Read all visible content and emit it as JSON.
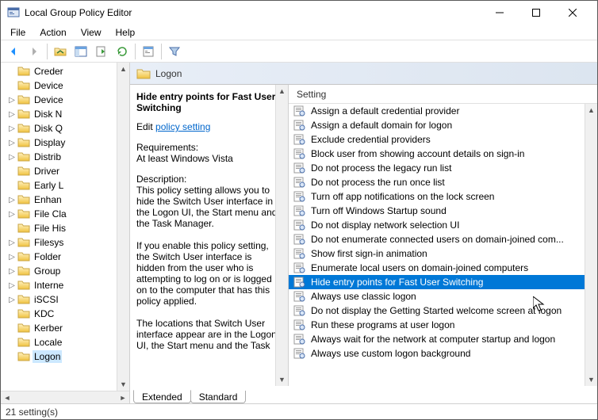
{
  "window": {
    "title": "Local Group Policy Editor"
  },
  "menu": [
    "File",
    "Action",
    "View",
    "Help"
  ],
  "tree": {
    "selected": "Logon",
    "items": [
      {
        "label": "Creder",
        "exp": ""
      },
      {
        "label": "Device",
        "exp": ""
      },
      {
        "label": "Device",
        "exp": ">"
      },
      {
        "label": "Disk N",
        "exp": ">"
      },
      {
        "label": "Disk Q",
        "exp": ">"
      },
      {
        "label": "Display",
        "exp": ">"
      },
      {
        "label": "Distrib",
        "exp": ">"
      },
      {
        "label": "Driver",
        "exp": ""
      },
      {
        "label": "Early L",
        "exp": ""
      },
      {
        "label": "Enhan",
        "exp": ">"
      },
      {
        "label": "File Cla",
        "exp": ">"
      },
      {
        "label": "File His",
        "exp": ""
      },
      {
        "label": "Filesys",
        "exp": ">"
      },
      {
        "label": "Folder",
        "exp": ">"
      },
      {
        "label": "Group",
        "exp": ">"
      },
      {
        "label": "Interne",
        "exp": ">"
      },
      {
        "label": "iSCSI",
        "exp": ">"
      },
      {
        "label": "KDC",
        "exp": ""
      },
      {
        "label": "Kerber",
        "exp": ""
      },
      {
        "label": "Locale",
        "exp": ""
      },
      {
        "label": "Logon",
        "exp": ""
      }
    ]
  },
  "content": {
    "heading": "Logon",
    "setting_title": "Hide entry points for Fast User Switching",
    "edit_prefix": "Edit ",
    "edit_link": "policy setting ",
    "req_hdr": "Requirements:",
    "req_val": "At least Windows Vista",
    "desc_hdr": "Description:",
    "desc_body": "This policy setting allows you to hide the Switch User interface in the Logon UI, the Start menu and the Task Manager.\n\nIf you enable this policy setting, the Switch User interface is hidden from the user who is attempting to log on or is logged on to the computer that has this policy applied.\n\nThe locations that Switch User interface appear are in the Logon UI, the Start menu and the Task"
  },
  "list": {
    "header": "Setting",
    "selected_index": 12,
    "items": [
      "Assign a default credential provider",
      "Assign a default domain for logon",
      "Exclude credential providers",
      "Block user from showing account details on sign-in",
      "Do not process the legacy run list",
      "Do not process the run once list",
      "Turn off app notifications on the lock screen",
      "Turn off Windows Startup sound",
      "Do not display network selection UI",
      "Do not enumerate connected users on domain-joined com...",
      "Show first sign-in animation",
      "Enumerate local users on domain-joined computers",
      "Hide entry points for Fast User Switching",
      "Always use classic logon",
      "Do not display the Getting Started welcome screen at logon",
      "Run these programs at user logon",
      "Always wait for the network at computer startup and logon",
      "Always use custom logon background"
    ]
  },
  "tabs": {
    "extended": "Extended",
    "standard": "Standard"
  },
  "status": "21 setting(s)"
}
